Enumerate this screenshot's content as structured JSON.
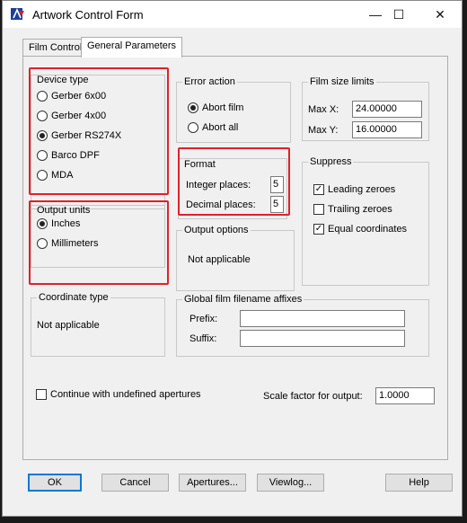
{
  "window": {
    "title": "Artwork Control Form",
    "minimize": "—",
    "maximize": "☐",
    "close": "✕"
  },
  "tabs": [
    {
      "label": "Film Control",
      "active": false
    },
    {
      "label": "General Parameters",
      "active": true
    }
  ],
  "device_type": {
    "title": "Device type",
    "options": [
      "Gerber 6x00",
      "Gerber 4x00",
      "Gerber RS274X",
      "Barco DPF",
      "MDA"
    ],
    "selected": "Gerber RS274X"
  },
  "output_units": {
    "title": "Output units",
    "options": [
      "Inches",
      "Millimeters"
    ],
    "selected": "Inches"
  },
  "coordinate_type": {
    "title": "Coordinate type",
    "value": "Not applicable"
  },
  "error_action": {
    "title": "Error action",
    "options": [
      "Abort film",
      "Abort all"
    ],
    "selected": "Abort film"
  },
  "format": {
    "title": "Format",
    "integer_label": "Integer places:",
    "integer_value": "5",
    "decimal_label": "Decimal places:",
    "decimal_value": "5"
  },
  "output_options": {
    "title": "Output options",
    "value": "Not applicable"
  },
  "film_size_limits": {
    "title": "Film size limits",
    "max_x_label": "Max X:",
    "max_x_value": "24.00000",
    "max_y_label": "Max Y:",
    "max_y_value": "16.00000"
  },
  "suppress": {
    "title": "Suppress",
    "items": [
      {
        "label": "Leading zeroes",
        "checked": true
      },
      {
        "label": "Trailing zeroes",
        "checked": false
      },
      {
        "label": "Equal coordinates",
        "checked": true
      }
    ]
  },
  "global_affixes": {
    "title": "Global film filename affixes",
    "prefix_label": "Prefix:",
    "prefix_value": "",
    "suffix_label": "Suffix:",
    "suffix_value": ""
  },
  "continue_undefined": {
    "label": "Continue with undefined apertures",
    "checked": false
  },
  "scale": {
    "label": "Scale factor for output:",
    "value": "1.0000"
  },
  "buttons": {
    "ok": "OK",
    "cancel": "Cancel",
    "apertures": "Apertures...",
    "viewlog": "Viewlog...",
    "help": "Help"
  },
  "colors": {
    "highlight": "#e0202a",
    "focus": "#0078d7"
  }
}
